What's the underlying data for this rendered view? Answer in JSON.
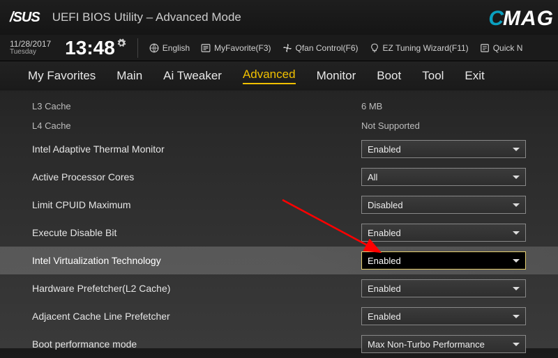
{
  "header": {
    "logo": "/SUS",
    "title": "UEFI BIOS Utility – Advanced Mode"
  },
  "brand": {
    "c": "C",
    "rest": "MAG"
  },
  "infobar": {
    "date": "11/28/2017",
    "day": "Tuesday",
    "time": "13:48",
    "language": "English",
    "favorite": "MyFavorite(F3)",
    "qfan": "Qfan Control(F6)",
    "eztuning": "EZ Tuning Wizard(F11)",
    "quicknote": "Quick N"
  },
  "tabs": {
    "items": [
      "My Favorites",
      "Main",
      "Ai Tweaker",
      "Advanced",
      "Monitor",
      "Boot",
      "Tool",
      "Exit"
    ],
    "active_index": 3
  },
  "rows": [
    {
      "type": "info",
      "label": "L3 Cache",
      "value": "6 MB"
    },
    {
      "type": "info",
      "label": "L4 Cache",
      "value": "Not Supported"
    },
    {
      "type": "setting",
      "label": "Intel Adaptive Thermal Monitor",
      "value": "Enabled"
    },
    {
      "type": "setting",
      "label": "Active Processor Cores",
      "value": "All"
    },
    {
      "type": "setting",
      "label": "Limit CPUID Maximum",
      "value": "Disabled"
    },
    {
      "type": "setting",
      "label": "Execute Disable Bit",
      "value": "Enabled"
    },
    {
      "type": "setting",
      "label": "Intel Virtualization Technology",
      "value": "Enabled",
      "selected": true
    },
    {
      "type": "setting",
      "label": "Hardware Prefetcher(L2 Cache)",
      "value": "Enabled"
    },
    {
      "type": "setting",
      "label": "Adjacent Cache Line Prefetcher",
      "value": "Enabled"
    },
    {
      "type": "setting",
      "label": "Boot performance mode",
      "value": "Max Non-Turbo Performance"
    }
  ]
}
